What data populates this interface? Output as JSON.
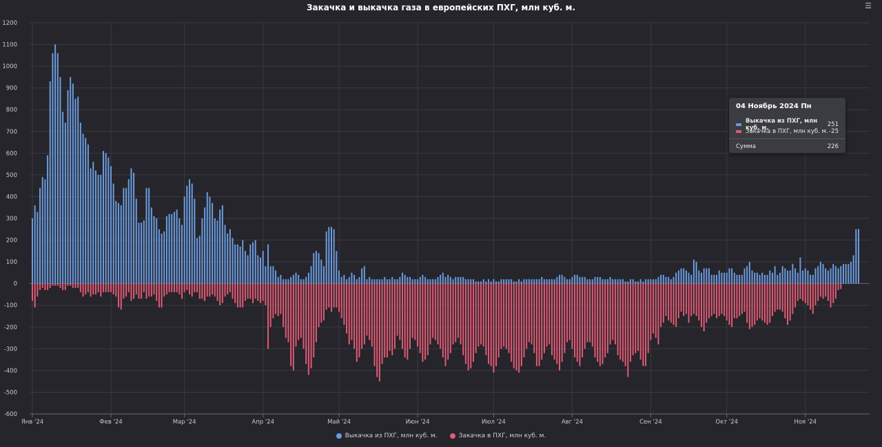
{
  "chart_data": {
    "type": "bar",
    "title": "Закачка и выкачка газа в европейских ПХГ, млн куб. м.",
    "ylim": [
      -600,
      1200
    ],
    "yticks": [
      1200,
      1100,
      1000,
      900,
      800,
      700,
      600,
      500,
      400,
      300,
      200,
      100,
      0,
      -100,
      -200,
      -300,
      -400,
      -500,
      -600
    ],
    "xticks": [
      "Янв '24",
      "Фев '24",
      "Мар '24",
      "Апр '24",
      "Май '24",
      "Июн '24",
      "Июл '24",
      "Авг '24",
      "Сен '24",
      "Окт '24",
      "Ноя '24"
    ],
    "grid": true,
    "legend_position": "bottom",
    "series": [
      {
        "name": "Выкачка из ПХГ, млн куб. м.",
        "color": "#6a9bde",
        "values": [
          300,
          360,
          330,
          440,
          490,
          480,
          590,
          930,
          1060,
          1100,
          1060,
          950,
          790,
          740,
          890,
          950,
          920,
          850,
          860,
          740,
          690,
          670,
          640,
          530,
          560,
          520,
          500,
          500,
          610,
          600,
          580,
          540,
          460,
          380,
          370,
          360,
          440,
          440,
          480,
          530,
          510,
          390,
          280,
          280,
          290,
          440,
          440,
          350,
          310,
          300,
          250,
          230,
          240,
          310,
          320,
          320,
          330,
          340,
          300,
          270,
          400,
          450,
          480,
          460,
          390,
          210,
          220,
          300,
          350,
          420,
          400,
          370,
          300,
          290,
          340,
          360,
          270,
          230,
          250,
          210,
          180,
          180,
          170,
          200,
          150,
          130,
          180,
          190,
          200,
          130,
          120,
          150,
          80,
          180,
          80,
          80,
          60,
          30,
          40,
          20,
          20,
          20,
          30,
          40,
          50,
          40,
          20,
          20,
          30,
          50,
          80,
          140,
          150,
          140,
          110,
          80,
          240,
          260,
          260,
          250,
          150,
          60,
          30,
          40,
          20,
          30,
          50,
          40,
          20,
          30,
          70,
          80,
          20,
          30,
          20,
          20,
          20,
          20,
          20,
          30,
          20,
          20,
          30,
          20,
          20,
          30,
          50,
          40,
          30,
          30,
          20,
          20,
          20,
          30,
          40,
          30,
          20,
          20,
          20,
          20,
          30,
          40,
          50,
          30,
          40,
          30,
          20,
          30,
          30,
          30,
          30,
          20,
          20,
          20,
          20,
          10,
          10,
          10,
          20,
          10,
          20,
          10,
          20,
          10,
          10,
          20,
          20,
          20,
          20,
          20,
          10,
          10,
          20,
          10,
          20,
          20,
          20,
          20,
          20,
          20,
          20,
          30,
          20,
          20,
          20,
          20,
          20,
          30,
          40,
          40,
          30,
          20,
          20,
          30,
          40,
          40,
          30,
          30,
          30,
          20,
          20,
          20,
          30,
          30,
          30,
          20,
          20,
          20,
          30,
          20,
          20,
          20,
          20,
          20,
          10,
          10,
          20,
          20,
          10,
          10,
          20,
          10,
          20,
          20,
          20,
          20,
          20,
          30,
          40,
          40,
          30,
          30,
          20,
          30,
          50,
          60,
          70,
          70,
          60,
          50,
          40,
          110,
          100,
          60,
          50,
          70,
          70,
          70,
          40,
          40,
          40,
          60,
          50,
          50,
          50,
          70,
          70,
          50,
          40,
          40,
          40,
          70,
          80,
          100,
          60,
          50,
          50,
          40,
          50,
          40,
          40,
          60,
          50,
          80,
          40,
          50,
          80,
          70,
          60,
          60,
          90,
          70,
          50,
          120,
          60,
          70,
          60,
          40,
          40,
          70,
          80,
          100,
          90,
          70,
          60,
          70,
          90,
          80,
          70,
          80,
          90,
          90,
          90,
          100,
          130,
          250,
          251
        ]
      },
      {
        "name": "Закачка в ПХГ, млн куб. м.",
        "color": "#e05a74",
        "values": [
          -80,
          -110,
          -60,
          -30,
          -20,
          -30,
          -30,
          -20,
          -10,
          -10,
          -10,
          -20,
          -30,
          -30,
          -10,
          -10,
          -20,
          -20,
          -20,
          -40,
          -60,
          -50,
          -40,
          -60,
          -50,
          -50,
          -40,
          -60,
          -40,
          -40,
          -40,
          -40,
          -50,
          -60,
          -110,
          -120,
          -70,
          -60,
          -40,
          -80,
          -70,
          -50,
          -70,
          -70,
          -40,
          -70,
          -60,
          -60,
          -50,
          -80,
          -110,
          -110,
          -60,
          -50,
          -40,
          -40,
          -40,
          -40,
          -50,
          -70,
          -40,
          -30,
          -50,
          -60,
          -40,
          -40,
          -70,
          -70,
          -80,
          -60,
          -60,
          -50,
          -60,
          -80,
          -100,
          -90,
          -60,
          -50,
          -40,
          -70,
          -90,
          -110,
          -110,
          -110,
          -80,
          -70,
          -70,
          -90,
          -70,
          -80,
          -90,
          -80,
          -100,
          -300,
          -200,
          -160,
          -140,
          -150,
          -140,
          -200,
          -250,
          -270,
          -380,
          -400,
          -290,
          -260,
          -250,
          -300,
          -370,
          -420,
          -390,
          -340,
          -270,
          -200,
          -180,
          -170,
          -120,
          -110,
          -130,
          -110,
          -110,
          -130,
          -160,
          -190,
          -230,
          -280,
          -260,
          -300,
          -360,
          -340,
          -300,
          -280,
          -240,
          -260,
          -290,
          -380,
          -430,
          -450,
          -370,
          -340,
          -340,
          -310,
          -330,
          -300,
          -240,
          -260,
          -300,
          -340,
          -350,
          -300,
          -250,
          -260,
          -290,
          -320,
          -360,
          -350,
          -330,
          -280,
          -250,
          -260,
          -280,
          -300,
          -340,
          -380,
          -350,
          -320,
          -280,
          -270,
          -250,
          -280,
          -330,
          -370,
          -400,
          -390,
          -360,
          -320,
          -290,
          -280,
          -290,
          -330,
          -370,
          -380,
          -410,
          -380,
          -340,
          -300,
          -290,
          -300,
          -320,
          -360,
          -390,
          -400,
          -410,
          -380,
          -340,
          -300,
          -270,
          -280,
          -320,
          -380,
          -380,
          -350,
          -320,
          -290,
          -280,
          -330,
          -350,
          -370,
          -400,
          -360,
          -320,
          -270,
          -260,
          -300,
          -340,
          -360,
          -380,
          -340,
          -300,
          -270,
          -270,
          -290,
          -340,
          -360,
          -380,
          -370,
          -340,
          -320,
          -280,
          -260,
          -280,
          -330,
          -350,
          -360,
          -380,
          -430,
          -360,
          -330,
          -320,
          -310,
          -350,
          -380,
          -380,
          -320,
          -260,
          -230,
          -250,
          -280,
          -200,
          -180,
          -150,
          -170,
          -180,
          -190,
          -200,
          -160,
          -130,
          -150,
          -140,
          -180,
          -150,
          -140,
          -150,
          -170,
          -200,
          -220,
          -180,
          -160,
          -150,
          -140,
          -160,
          -150,
          -140,
          -150,
          -170,
          -190,
          -200,
          -160,
          -160,
          -150,
          -140,
          -130,
          -180,
          -210,
          -200,
          -190,
          -170,
          -160,
          -170,
          -180,
          -190,
          -180,
          -150,
          -130,
          -120,
          -120,
          -130,
          -160,
          -190,
          -170,
          -140,
          -110,
          -80,
          -70,
          -80,
          -90,
          -100,
          -120,
          -140,
          -100,
          -80,
          -60,
          -70,
          -60,
          -80,
          -110,
          -90,
          -70,
          -30,
          -25
        ]
      }
    ]
  },
  "tooltip": {
    "title": "04 Ноябрь 2024 Пн",
    "rows": [
      {
        "name": "Выкачка из ПХГ, млн куб. м.",
        "value": "251",
        "color": "#6a9bde"
      },
      {
        "name": "Закачка в ПХГ, млн куб. м.",
        "value": "-25",
        "color": "#e05a74"
      }
    ],
    "sum_label": "Сумма",
    "sum_value": "226"
  },
  "menu_icon": "hamburger-menu-icon"
}
